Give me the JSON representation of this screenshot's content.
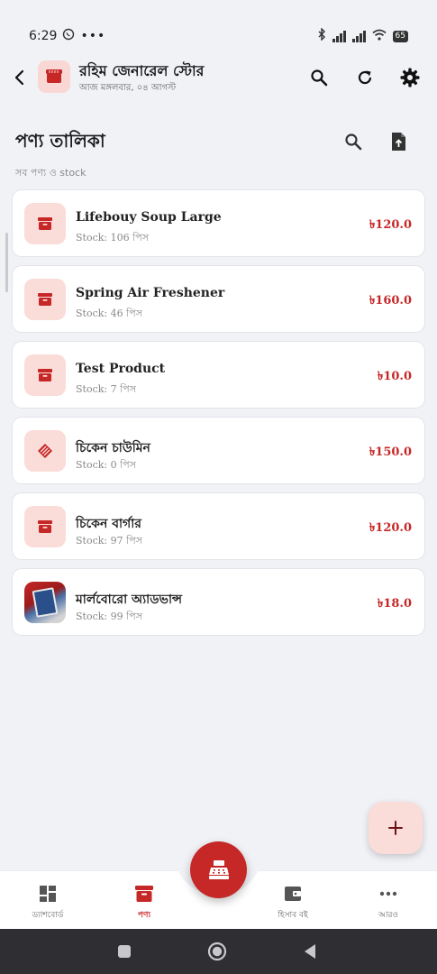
{
  "status_bar": {
    "time": "6:29",
    "battery": "65"
  },
  "header": {
    "store_name": "রহিম জেনারেল স্টোর",
    "date": "আজ মঙ্গলবার, ০৪ আগস্ট"
  },
  "section": {
    "title": "পণ্য তালিকা",
    "subtitle": "সব পণ্য ও stock"
  },
  "products": [
    {
      "name": "Lifebouy Soup Large",
      "stock": "Stock: 106 পিস",
      "price": "৳120.0",
      "icon": "archive-box-icon"
    },
    {
      "name": "Spring Air Freshener",
      "stock": "Stock: 46 পিস",
      "price": "৳160.0",
      "icon": "archive-box-icon"
    },
    {
      "name": "Test Product",
      "stock": "Stock: 7 পিস",
      "price": "৳10.0",
      "icon": "archive-box-icon"
    },
    {
      "name": "চিকেন চাউমিন",
      "stock": "Stock: 0 পিস",
      "price": "৳150.0",
      "icon": "stacked-diamond-icon"
    },
    {
      "name": "চিকেন বার্গার",
      "stock": "Stock: 97 পিস",
      "price": "৳120.0",
      "icon": "archive-box-icon"
    },
    {
      "name": "মার্লবোরো অ্যাডভান্স",
      "stock": "Stock: 99 পিস",
      "price": "৳18.0",
      "icon": "product-photo"
    }
  ],
  "bottom_nav": {
    "dashboard": "ড্যাশবোর্ড",
    "products": "পণ্য",
    "ledger": "হিসাব বই",
    "more": "আরও"
  },
  "colors": {
    "accent": "#c62828",
    "accent_soft": "#fadcd8",
    "background": "#f1f2f6"
  }
}
